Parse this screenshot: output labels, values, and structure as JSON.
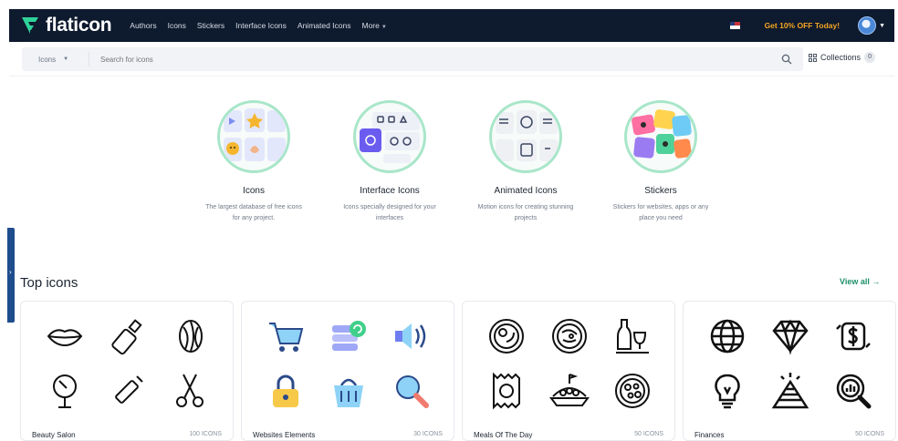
{
  "header": {
    "logo_text": "flaticon",
    "nav": [
      "Authors",
      "Icons",
      "Stickers",
      "Interface Icons",
      "Animated Icons",
      "More"
    ],
    "promo": "Get 10% OFF Today!",
    "colors": {
      "bg": "#0e1a2e",
      "promo": "#f5a623",
      "brand_green": "#2fd39a"
    }
  },
  "search": {
    "type_label": "Icons",
    "placeholder": "Search for icons",
    "collections_label": "Collections",
    "collections_count": "0"
  },
  "categories": [
    {
      "title": "Icons",
      "desc": "The largest database of free icons for any project."
    },
    {
      "title": "Interface Icons",
      "desc": "Icons specially designed for your interfaces"
    },
    {
      "title": "Animated Icons",
      "desc": "Motion icons for creating stunning projects"
    },
    {
      "title": "Stickers",
      "desc": "Stickers for websites, apps or any place you need"
    }
  ],
  "top_icons": {
    "title": "Top icons",
    "view_all": "View all →",
    "packs": [
      {
        "name": "Beauty Salon",
        "count": "100 ICONS",
        "icons": [
          "lips-icon",
          "lotion-bottle-icon",
          "hair-icon",
          "hand-mirror-icon",
          "ampoule-icon",
          "scissors-icon"
        ]
      },
      {
        "name": "Websites Elements",
        "count": "30 ICONS",
        "icons": [
          "shopping-cart-icon",
          "database-sync-icon",
          "speaker-icon",
          "padlock-icon",
          "basket-icon",
          "magnifier-icon"
        ]
      },
      {
        "name": "Meals Of The Day",
        "count": "50 ICONS",
        "icons": [
          "breakfast-plate-icon",
          "salad-plate-icon",
          "bottle-and-glass-icon",
          "snack-bag-icon",
          "food-tray-icon",
          "soup-bowl-icon"
        ]
      },
      {
        "name": "Finances",
        "count": "50 ICONS",
        "icons": [
          "globe-icon",
          "diamond-icon",
          "dollar-exchange-icon",
          "lightbulb-icon",
          "pyramid-icon",
          "analytics-search-icon"
        ]
      }
    ]
  }
}
